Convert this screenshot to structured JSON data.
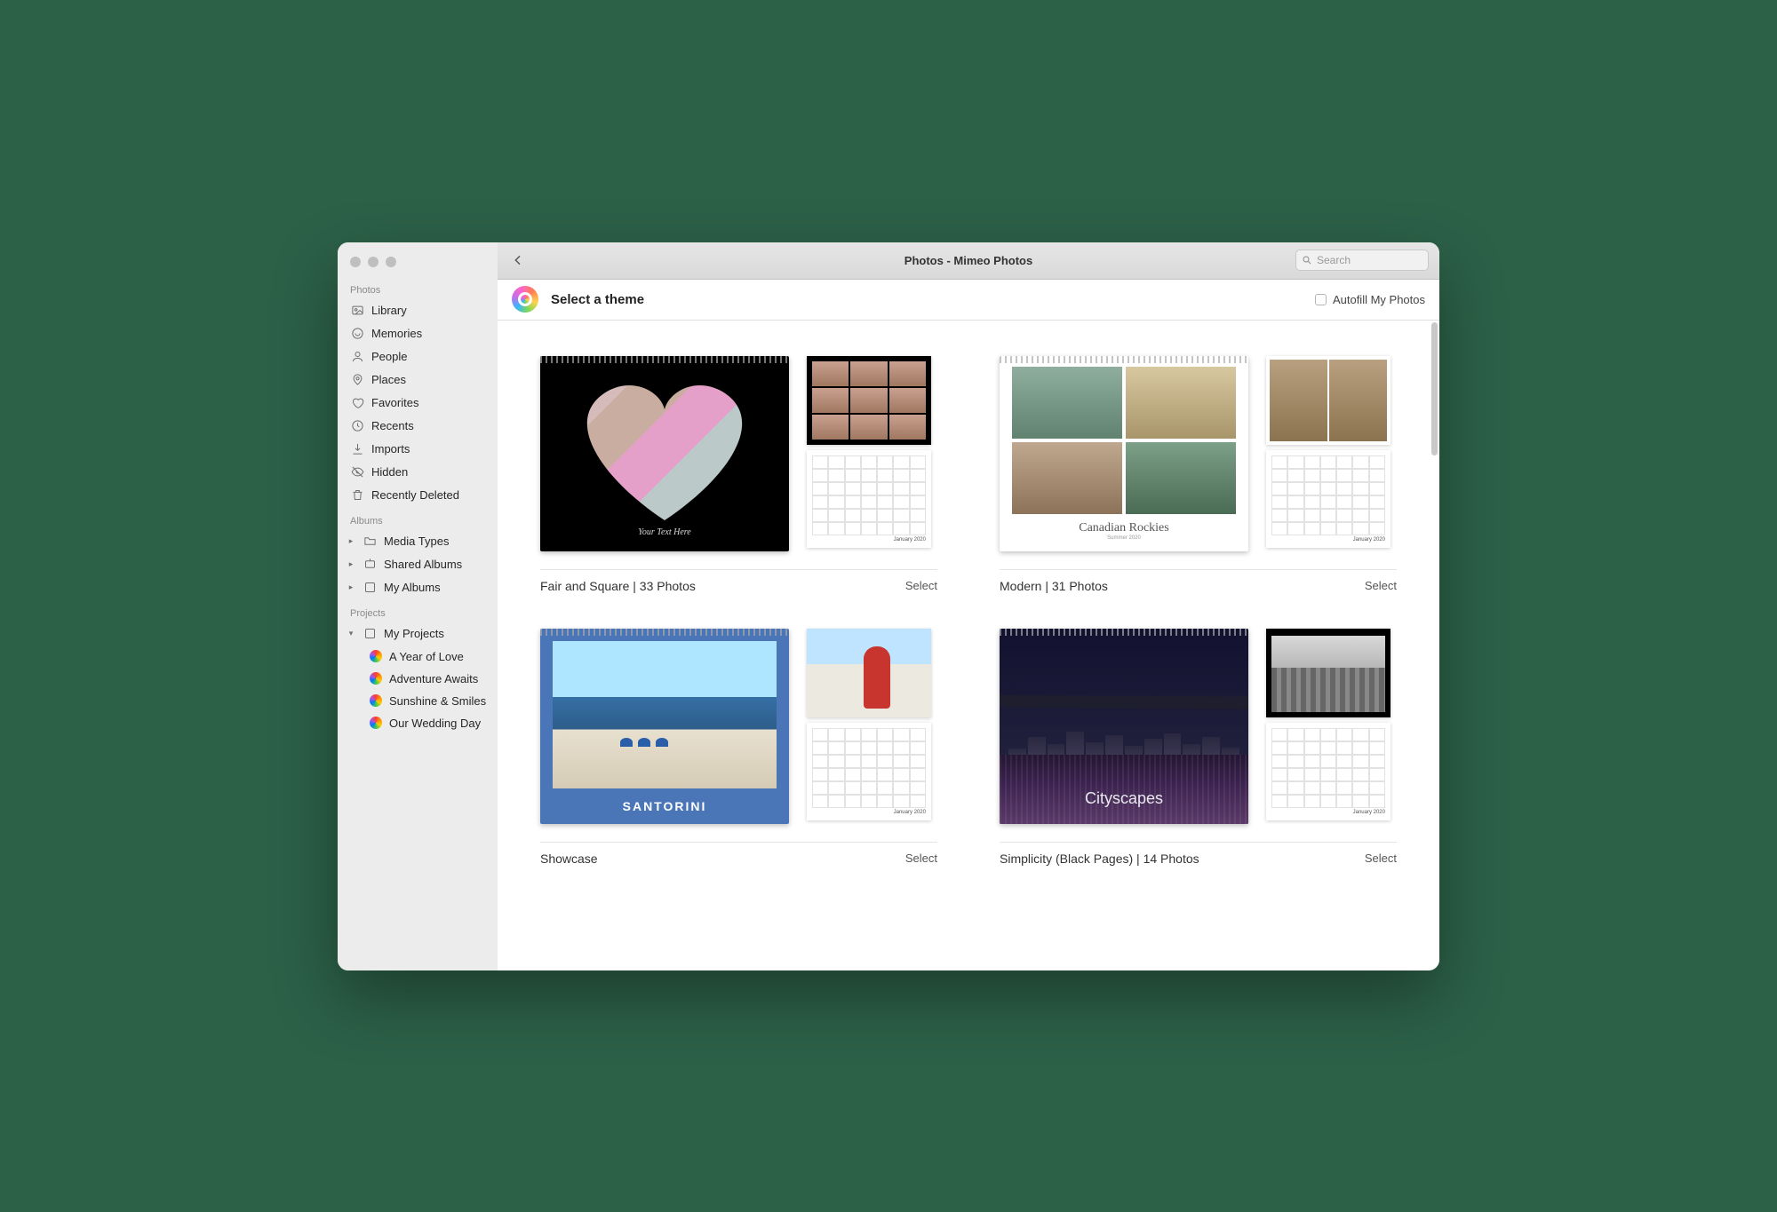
{
  "window_title": "Photos - Mimeo Photos",
  "search_placeholder": "Search",
  "subheader_title": "Select a theme",
  "autofill_label": "Autofill My Photos",
  "sidebar": {
    "sections": {
      "photos_label": "Photos",
      "albums_label": "Albums",
      "projects_label": "Projects"
    },
    "photos": [
      {
        "label": "Library"
      },
      {
        "label": "Memories"
      },
      {
        "label": "People"
      },
      {
        "label": "Places"
      },
      {
        "label": "Favorites"
      },
      {
        "label": "Recents"
      },
      {
        "label": "Imports"
      },
      {
        "label": "Hidden"
      },
      {
        "label": "Recently Deleted"
      }
    ],
    "albums": [
      {
        "label": "Media Types"
      },
      {
        "label": "Shared Albums"
      },
      {
        "label": "My Albums"
      }
    ],
    "my_projects_label": "My Projects",
    "projects": [
      {
        "label": "A Year of Love"
      },
      {
        "label": "Adventure Awaits"
      },
      {
        "label": "Sunshine & Smiles"
      },
      {
        "label": "Our Wedding Day"
      }
    ]
  },
  "themes": [
    {
      "name": "Fair and Square | 33 Photos",
      "select_label": "Select",
      "cover_caption": "Your Text Here",
      "cal_month": "January 2020"
    },
    {
      "name": "Modern | 31 Photos",
      "select_label": "Select",
      "cover_title": "Canadian Rockies",
      "cover_sub": "Summer 2020",
      "cal_month": "January 2020"
    },
    {
      "name": "Showcase",
      "select_label": "Select",
      "cover_title": "SANTORINI",
      "cal_month": "January 2020"
    },
    {
      "name": "Simplicity (Black Pages) | 14 Photos",
      "select_label": "Select",
      "cover_title": "Cityscapes",
      "cal_month": "January 2020"
    }
  ]
}
